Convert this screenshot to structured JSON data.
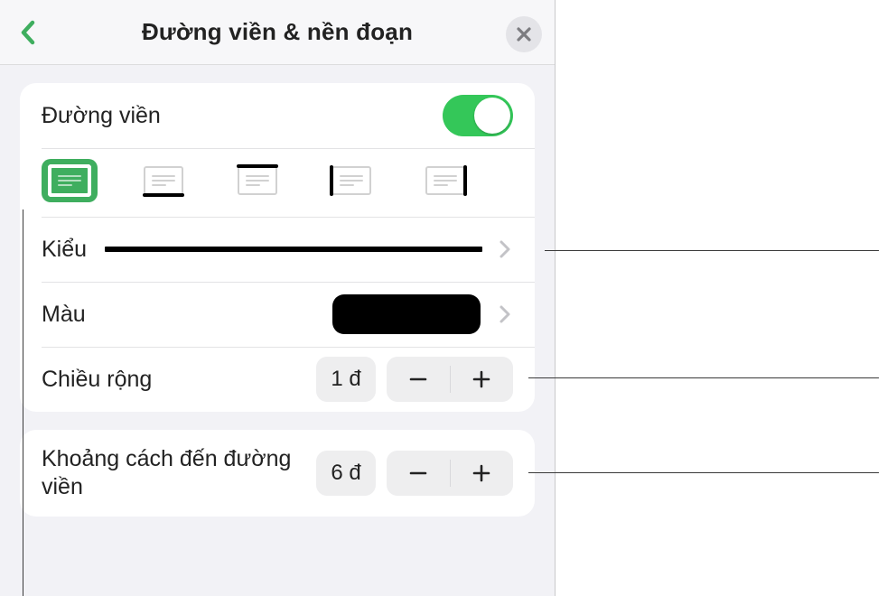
{
  "header": {
    "title": "Đường viền & nền đoạn"
  },
  "group1": {
    "border_label": "Đường viền",
    "toggle_on": true
  },
  "border_positions": {
    "selected_index": 0,
    "items": [
      "all",
      "bottom",
      "top",
      "left",
      "right"
    ]
  },
  "style_row": {
    "label": "Kiểu"
  },
  "color_row": {
    "label": "Màu",
    "color": "#000000"
  },
  "width_row": {
    "label": "Chiều rộng",
    "value": "1 đ"
  },
  "offset_row": {
    "label": "Khoảng cách đến đường viền",
    "value": "6 đ"
  }
}
